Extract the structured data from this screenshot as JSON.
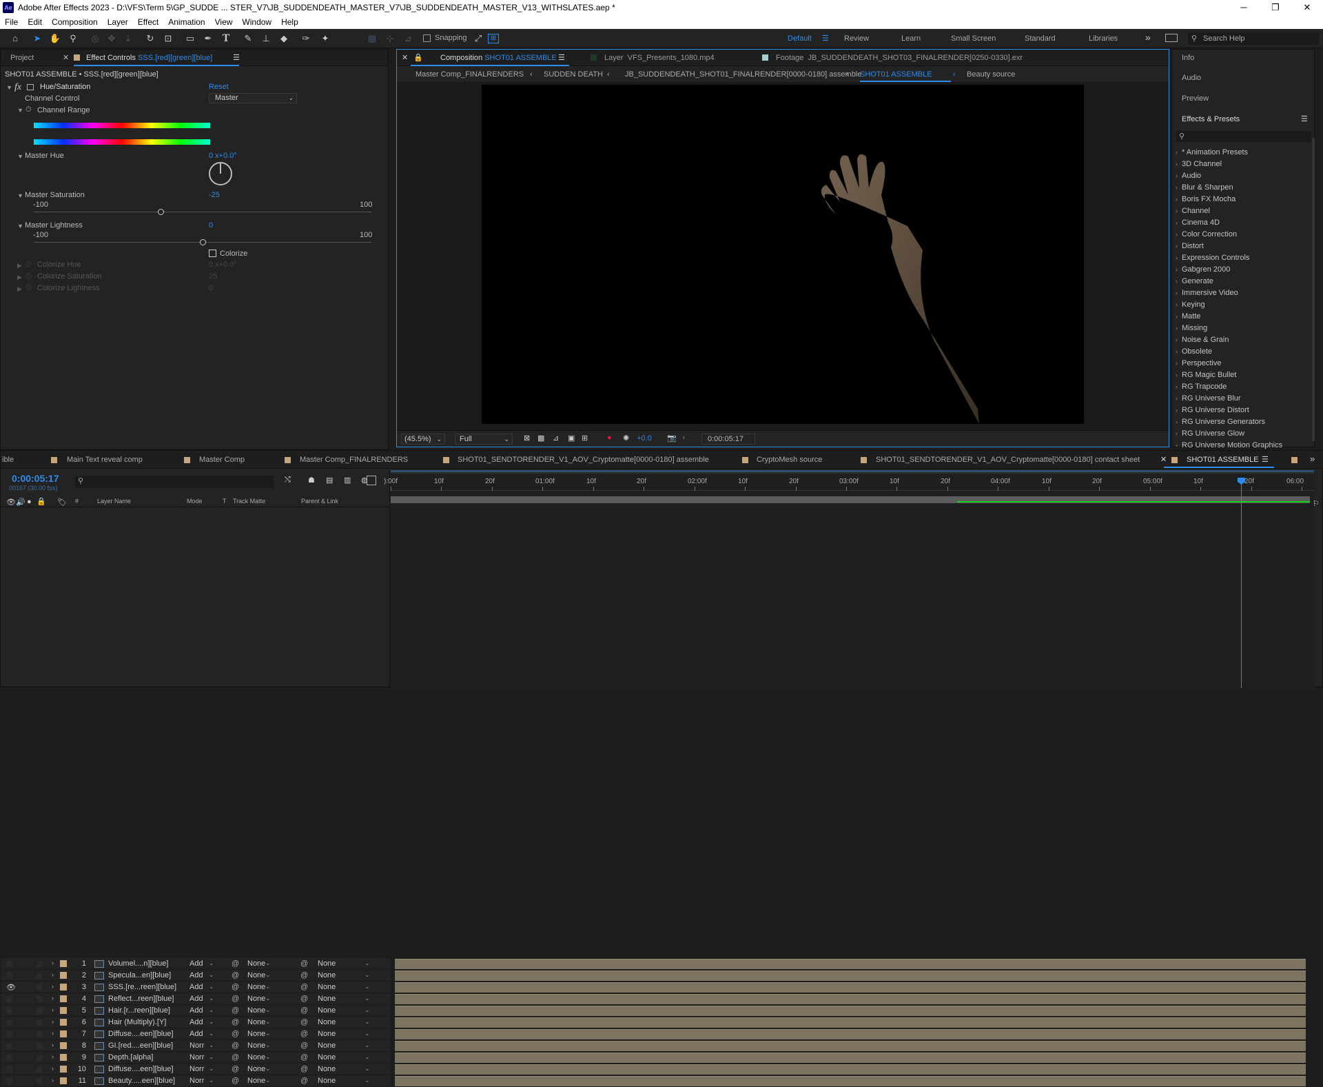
{
  "window": {
    "title": "Adobe After Effects 2023 - D:\\VFS\\Term 5\\GP_SUDDE ... STER_V7\\JB_SUDDENDEATH_MASTER_V7\\JB_SUDDENDEATH_MASTER_V13_WITHSLATES.aep *",
    "logo": "Ae",
    "min": "─",
    "max": "❐",
    "close": "✕"
  },
  "menu": [
    "File",
    "Edit",
    "Composition",
    "Layer",
    "Effect",
    "Animation",
    "View",
    "Window",
    "Help"
  ],
  "toolbar": {
    "snapping": "Snapping",
    "workspaces": [
      "Default",
      "Review",
      "Learn",
      "Small Screen",
      "Standard",
      "Libraries"
    ],
    "active": "Default",
    "more": "»",
    "search": "Search Help"
  },
  "effect_controls": {
    "tabs": {
      "project": "Project",
      "effect_label": "Effect Controls",
      "effect_target": "SSS.[red][green][blue]"
    },
    "header": "SHOT01 ASSEMBLE • SSS.[red][green][blue]",
    "effect_name": "Hue/Saturation",
    "reset": "Reset",
    "channel_control_label": "Channel Control",
    "channel_control_value": "Master",
    "channel_range": "Channel Range",
    "master_hue": "Master Hue",
    "master_hue_value": "0 x+0.0°",
    "master_saturation": "Master Saturation",
    "master_saturation_value": "-25",
    "sat_min": "-100",
    "sat_max": "100",
    "master_lightness": "Master Lightness",
    "master_lightness_value": "0",
    "light_min": "-100",
    "light_max": "100",
    "colorize": "Colorize",
    "colorize_hue": "Colorize Hue",
    "colorize_hue_value": "0 x+0.0°",
    "colorize_saturation": "Colorize Saturation",
    "colorize_saturation_value": "25",
    "colorize_lightness": "Colorize Lightness",
    "colorize_lightness_value": "0",
    "saturation_slider": 0.375,
    "lightness_slider": 0.5
  },
  "viewer": {
    "tabs": {
      "composition_label": "Composition",
      "composition_name": "SHOT01 ASSEMBLE",
      "layer_label": "Layer",
      "layer_name": "VFS_Presents_1080.mp4",
      "footage_label": "Footage",
      "footage_name": "JB_SUDDENDEATH_SHOT03_FINALRENDER[0250-0330].exr"
    },
    "breadcrumbs": [
      "Master Comp_FINALRENDERS",
      "SUDDEN DEATH",
      "JB_SUDDENDEATH_SHOT01_FINALRENDER[0000-0180] assemble",
      "SHOT01 ASSEMBLE",
      "Beauty source"
    ],
    "zoom": "(45.5%)",
    "resolution": "Full",
    "exposure": "+0.0",
    "timecode": "0:00:05:17"
  },
  "right_panels": {
    "info": "Info",
    "audio": "Audio",
    "preview": "Preview",
    "effects_presets": "Effects & Presets",
    "presets": [
      "* Animation Presets",
      "3D Channel",
      "Audio",
      "Blur & Sharpen",
      "Boris FX Mocha",
      "Channel",
      "Cinema 4D",
      "Color Correction",
      "Distort",
      "Expression Controls",
      "Gabgren 2000",
      "Generate",
      "Immersive Video",
      "Keying",
      "Matte",
      "Missing",
      "Noise & Grain",
      "Obsolete",
      "Perspective",
      "RG Magic Bullet",
      "RG Trapcode",
      "RG Universe Blur",
      "RG Universe Distort",
      "RG Universe Generators",
      "RG Universe Glow",
      "RG Universe Motion Graphics"
    ]
  },
  "timeline": {
    "comp_tabs": [
      "ible",
      "Main Text reveal comp",
      "Master Comp",
      "Master Comp_FINALRENDERS",
      "SHOT01_SENDTORENDER_V1_AOV_Cryptomatte[0000-0180] assemble",
      "CryptoMesh source",
      "SHOT01_SENDTORENDER_V1_AOV_Cryptomatte[0000-0180] contact sheet",
      "SHOT01 ASSEMBLE"
    ],
    "current_time": "0:00:05:17",
    "frame_info": "00167 (30.00 fps)",
    "headers": {
      "num": "#",
      "layer_name": "Layer Name",
      "mode": "Mode",
      "t": "T",
      "track_matte": "Track Matte",
      "parent": "Parent & Link"
    },
    "layers": [
      {
        "num": "1",
        "name": "Volumel....n][blue]",
        "mode": "Add",
        "matte": "None",
        "parent": "None"
      },
      {
        "num": "2",
        "name": "Specula...en][blue]",
        "mode": "Add",
        "matte": "None",
        "parent": "None"
      },
      {
        "num": "3",
        "name": "SSS.[re...reen][blue]",
        "mode": "Add",
        "matte": "None",
        "parent": "None"
      },
      {
        "num": "4",
        "name": "Reflect...reen][blue]",
        "mode": "Add",
        "matte": "None",
        "parent": "None"
      },
      {
        "num": "5",
        "name": "Hair.[r...reen][blue]",
        "mode": "Add",
        "matte": "None",
        "parent": "None"
      },
      {
        "num": "6",
        "name": "Hair (Multiply).[Y]",
        "mode": "Add",
        "matte": "None",
        "parent": "None"
      },
      {
        "num": "7",
        "name": "Diffuse....een][blue]",
        "mode": "Add",
        "matte": "None",
        "parent": "None"
      },
      {
        "num": "8",
        "name": "GI.[red....een][blue]",
        "mode": "Norr",
        "matte": "None",
        "parent": "None"
      },
      {
        "num": "9",
        "name": "Depth.[alpha]",
        "mode": "Norr",
        "matte": "None",
        "parent": "None"
      },
      {
        "num": "10",
        "name": "Diffuse....een][blue]",
        "mode": "Norr",
        "matte": "None",
        "parent": "None"
      },
      {
        "num": "11",
        "name": "Beauty.....een][blue]",
        "mode": "Norr",
        "matte": "None",
        "parent": "None"
      }
    ],
    "ruler": [
      "):00f",
      "10f",
      "20f",
      "01:00f",
      "10f",
      "20f",
      "02:00f",
      "10f",
      "20f",
      "03:00f",
      "10f",
      "20f",
      "04:00f",
      "10f",
      "20f",
      "05:00f",
      "10f",
      "20f",
      "06:00"
    ],
    "playhead_fraction": 0.93
  },
  "colors": {
    "accent": "#2d8ceb",
    "layer_bar": "#7c7360",
    "label_tan": "#c8a57a"
  }
}
